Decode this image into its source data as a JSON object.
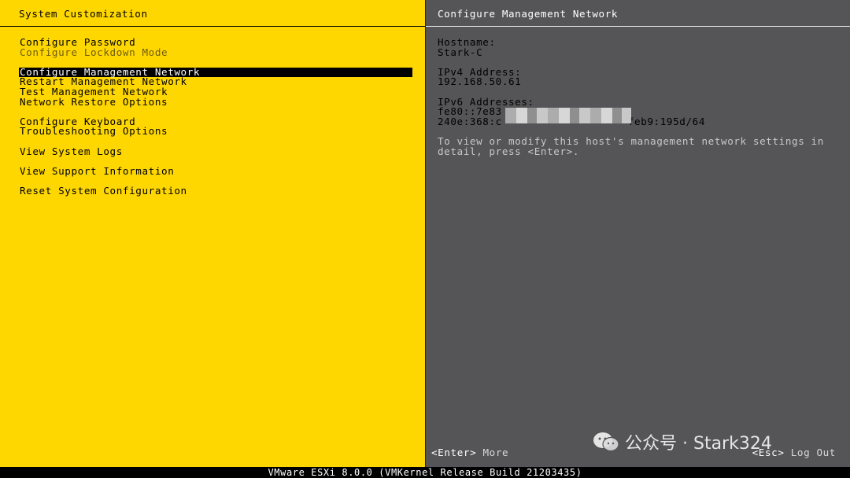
{
  "left_panel": {
    "title": "System Customization",
    "groups": [
      [
        {
          "label": "Configure Password",
          "state": "normal"
        },
        {
          "label": "Configure Lockdown Mode",
          "state": "disabled"
        }
      ],
      [
        {
          "label": "Configure Management Network",
          "state": "selected"
        },
        {
          "label": "Restart Management Network",
          "state": "normal"
        },
        {
          "label": "Test Management Network",
          "state": "normal"
        },
        {
          "label": "Network Restore Options",
          "state": "normal"
        }
      ],
      [
        {
          "label": "Configure Keyboard",
          "state": "normal"
        },
        {
          "label": "Troubleshooting Options",
          "state": "normal"
        }
      ],
      [
        {
          "label": "View System Logs",
          "state": "normal"
        }
      ],
      [
        {
          "label": "View Support Information",
          "state": "normal"
        }
      ],
      [
        {
          "label": "Reset System Configuration",
          "state": "normal"
        }
      ]
    ]
  },
  "right_panel": {
    "title": "Configure Management Network",
    "hostname_label": "Hostname:",
    "hostname_value": "Stark-C",
    "ipv4_label": "IPv4 Address:",
    "ipv4_value": "192.168.50.61",
    "ipv6_label": "IPv6 Addresses:",
    "ipv6_line1_prefix": "fe80::7e83",
    "ipv6_line2_prefix": "240e:368:c",
    "ipv6_line2_suffix": "feb9:195d/64",
    "hint_line1": "To view or modify this host's management network settings in",
    "hint_line2": "detail, press <Enter>."
  },
  "actions": {
    "enter_key": "<Enter>",
    "enter_label": "More",
    "esc_key": "<Esc>",
    "esc_label": "Log Out"
  },
  "watermark": {
    "text": "公众号 · Stark324"
  },
  "footer": {
    "text": "VMware ESXi 8.0.0 (VMKernel Release Build 21203435)"
  },
  "colors": {
    "left_bg": "#ffd700",
    "right_bg": "#555557",
    "selection_bg": "#000000"
  }
}
